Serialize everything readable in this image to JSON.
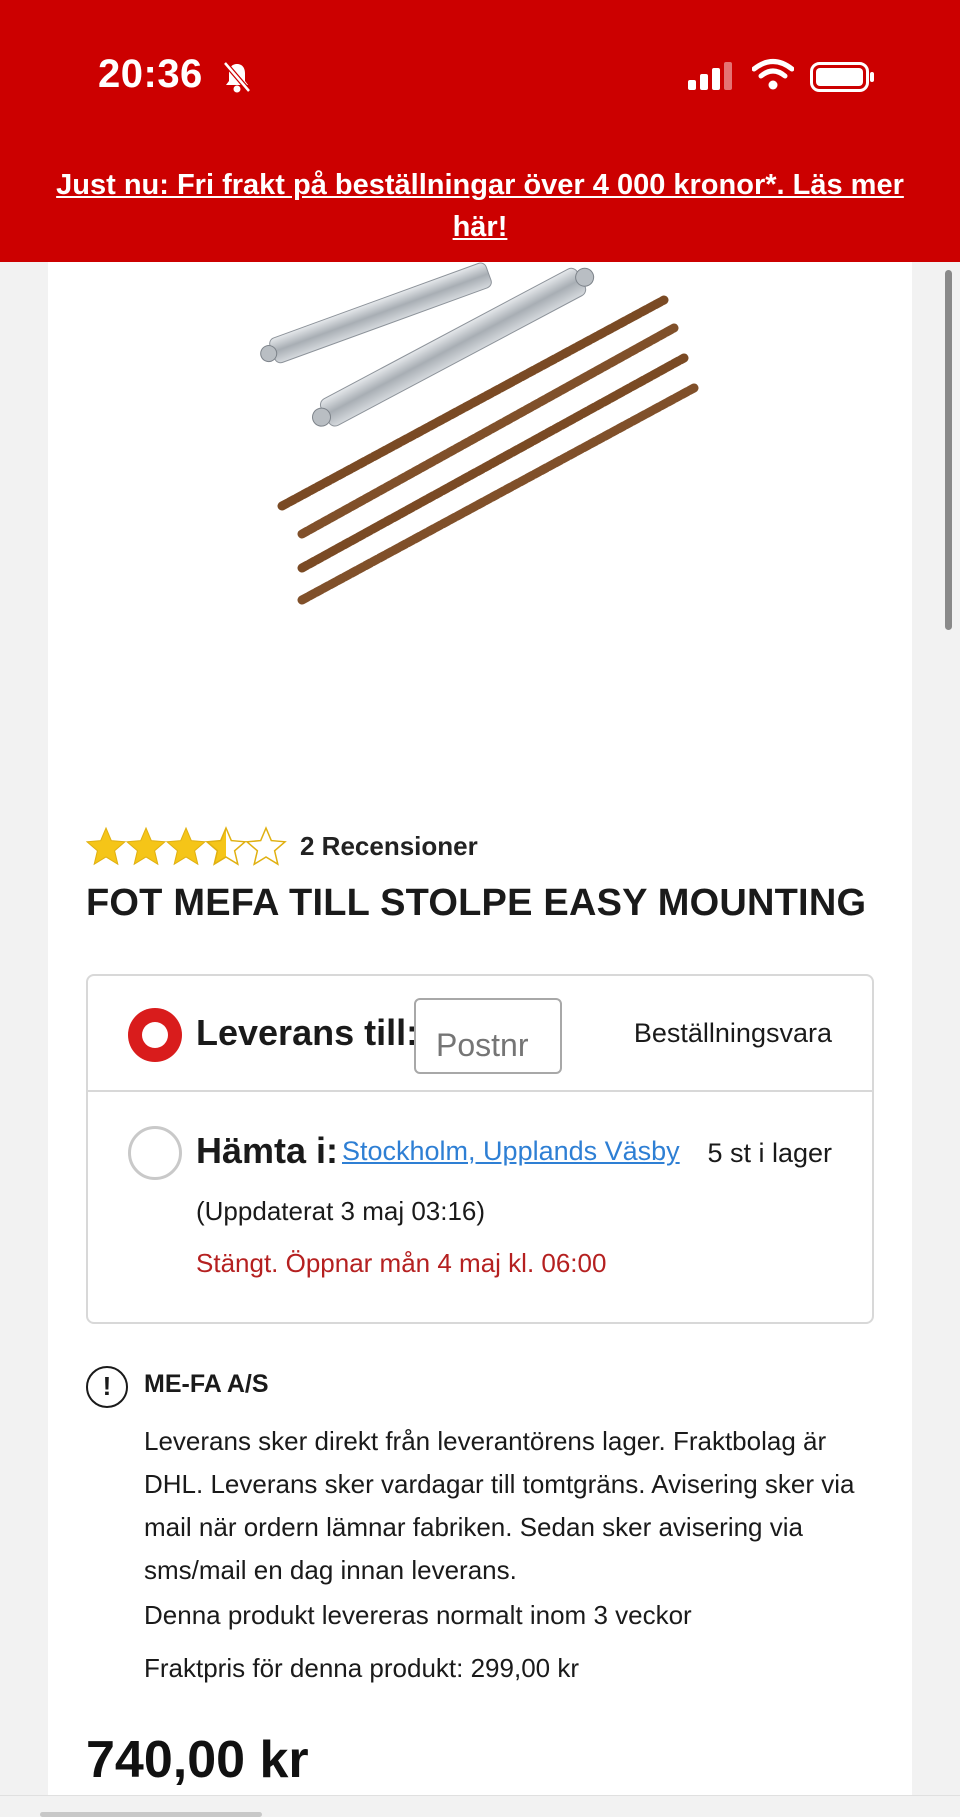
{
  "status_bar": {
    "time": "20:36",
    "icons": [
      "bell-slash-icon",
      "cellular-signal-icon",
      "wifi-icon",
      "battery-icon"
    ]
  },
  "banner": {
    "text": "Just nu: Fri frakt på beställningar över 4 000 kronor*. Läs mer här!"
  },
  "product": {
    "rating_value": 3.5,
    "rating_max": 5,
    "review_count_label": "2 Recensioner",
    "title": "FOT MEFA TILL STOLPE EASY MOUNTING",
    "price": "740,00 kr"
  },
  "delivery": {
    "option_delivery_label": "Leverans till:",
    "postnr_placeholder": "Postnr",
    "order_item_label": "Beställningsvara",
    "option_pickup_label": "Hämta i:",
    "store_name": "Stockholm, Upplands Väsby",
    "stock_label": "5 st i lager",
    "updated_label": "(Uppdaterat 3 maj 03:16)",
    "closed_label": "Stängt. Öppnar mån 4 maj kl. 06:00"
  },
  "supplier_info": {
    "name": "ME-FA A/S",
    "description": "Leverans sker direkt från leverantörens lager. Fraktbolag är DHL. Leverans sker vardagar till tomtgräns. Avisering sker via mail när ordern lämnar fabriken. Sedan sker avisering via sms/mail en dag innan leverans.",
    "delivery_time": "Denna produkt levereras normalt inom 3 veckor",
    "freight_price": "Fraktpris för denna produkt: 299,00 kr"
  },
  "colors": {
    "brand_red": "#cc0000",
    "star_yellow": "#f5c518",
    "link_blue": "#2e7fd4",
    "closed_red": "#b52020"
  }
}
